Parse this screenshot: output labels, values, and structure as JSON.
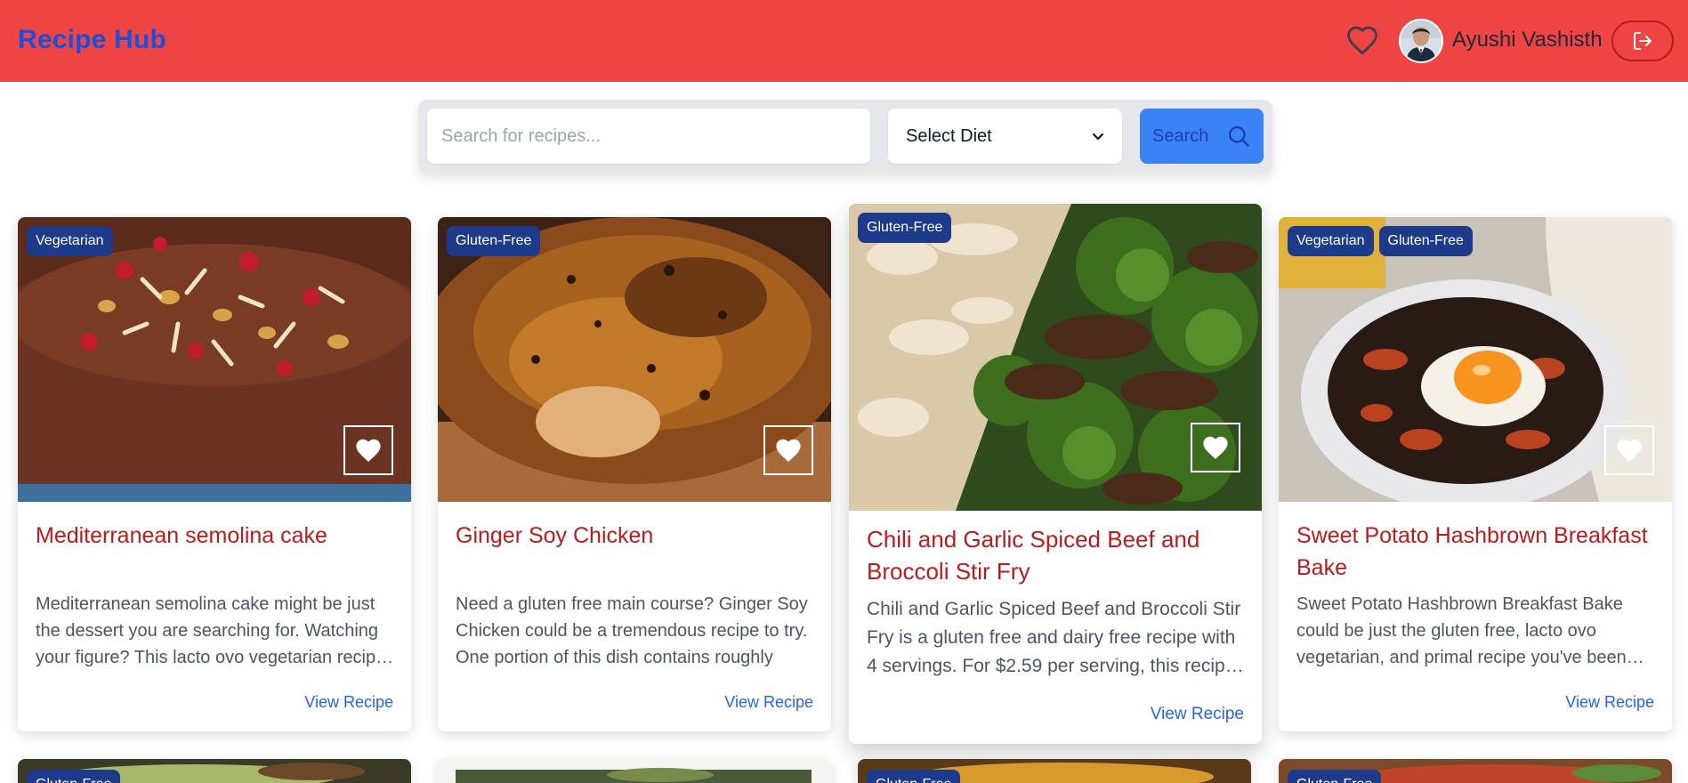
{
  "header": {
    "brand": "Recipe Hub",
    "user_name": "Ayushi Vashisth",
    "icons": [
      "heart-outline-icon",
      "avatar",
      "logout-icon"
    ],
    "bg_color": "#ef4444",
    "brand_color": "#1d4ed8"
  },
  "search": {
    "placeholder": "Search for recipes...",
    "value": "",
    "diet_selected": "Select Diet",
    "button_label": "Search"
  },
  "recipes": [
    {
      "badges": [
        "Vegetarian"
      ],
      "title": "Mediterranean semolina cake",
      "description": "Mediterranean semolina cake might be just the dessert you are searching for. Watching your figure? This lacto ovo vegetarian recipe has",
      "link": "View Recipe"
    },
    {
      "badges": [
        "Gluten-Free"
      ],
      "title": "Ginger Soy Chicken",
      "description": "Need a gluten free main course? Ginger Soy Chicken could be a tremendous recipe to try. One portion of this dish contains roughly",
      "link": "View Recipe"
    },
    {
      "badges": [
        "Gluten-Free"
      ],
      "title": "Chili and Garlic Spiced Beef and Broccoli Stir Fry",
      "description": "Chili and Garlic Spiced Beef and Broccoli Stir Fry is a gluten free and dairy free recipe with 4 servings. For $2.59 per serving, this recipe covers",
      "link": "View Recipe"
    },
    {
      "badges": [
        "Vegetarian",
        "Gluten-Free"
      ],
      "title": "Sweet Potato Hashbrown Breakfast Bake",
      "description": "Sweet Potato Hashbrown Breakfast Bake could be just the gluten free, lacto ovo vegetarian, and primal recipe you've been looking for.",
      "link": "View Recipe"
    }
  ],
  "second_row_badges": [
    "Gluten-Free",
    "",
    "Gluten-Free",
    "Gluten-Free"
  ],
  "colors": {
    "badge": "#1e3a8a",
    "title": "#b91c1c",
    "link": "#2563eb",
    "search_button": "#3b82f6"
  }
}
